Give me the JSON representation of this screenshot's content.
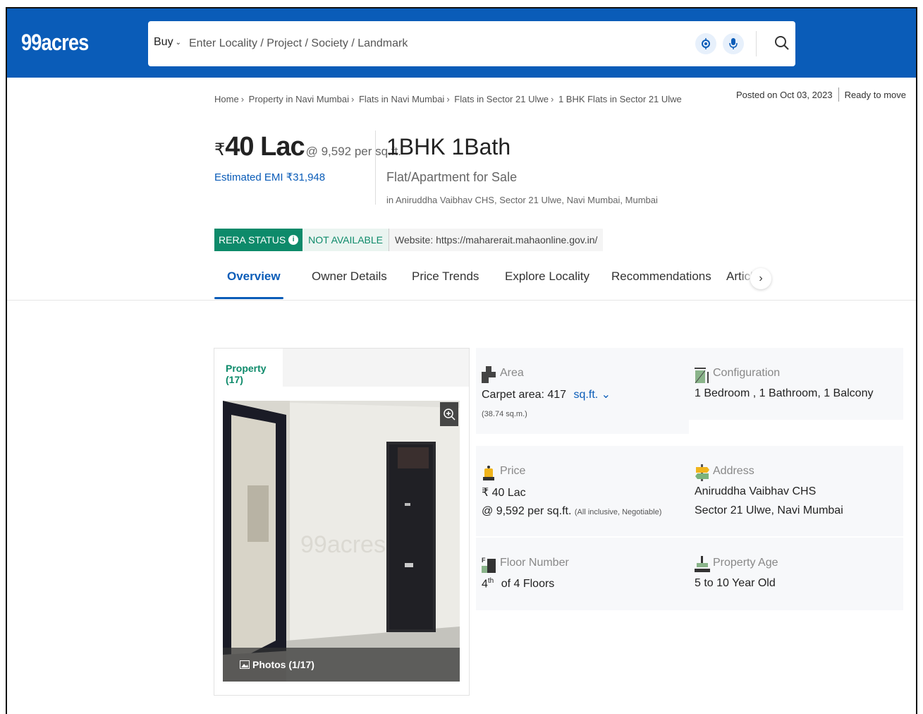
{
  "header": {
    "logo": "99acres",
    "search": {
      "mode": "Buy",
      "placeholder": "Enter Locality / Project / Society / Landmark"
    }
  },
  "meta": {
    "posted": "Posted on Oct 03, 2023",
    "status": "Ready to move"
  },
  "breadcrumb": [
    "Home",
    "Property in Navi Mumbai",
    "Flats in Navi Mumbai",
    "Flats in Sector 21 Ulwe",
    "1 BHK Flats in Sector 21 Ulwe"
  ],
  "listing": {
    "currency": "₹",
    "price": "40 Lac",
    "per_sqft": "@ 9,592 per sq.ft.",
    "emi": "Estimated EMI ₹31,948",
    "config": "1BHK 1Bath",
    "type": "Flat/Apartment for Sale",
    "location": "in Aniruddha Vaibhav CHS, Sector 21 Ulwe, Navi Mumbai, Mumbai"
  },
  "rera": {
    "label": "RERA STATUS",
    "status": "NOT AVAILABLE",
    "website": "Website: https://maharerait.mahaonline.gov.in/"
  },
  "tabs": [
    "Overview",
    "Owner Details",
    "Price Trends",
    "Explore Locality",
    "Recommendations",
    "Articles"
  ],
  "gallery": {
    "tab": "Property (17)",
    "photos_label": "Photos (1/17)"
  },
  "details": {
    "area": {
      "label": "Area",
      "value": "Carpet area: 417",
      "unit": "sq.ft.",
      "sub": "(38.74 sq.m.)"
    },
    "configuration": {
      "label": "Configuration",
      "value": "1 Bedroom , 1 Bathroom, 1 Balcony"
    },
    "price": {
      "label": "Price",
      "value": "₹ 40 Lac",
      "sub": "@ 9,592 per sq.ft.",
      "note": "(All inclusive, Negotiable)"
    },
    "address": {
      "label": "Address",
      "line1": "Aniruddha Vaibhav CHS",
      "line2": "Sector 21 Ulwe, Navi Mumbai"
    },
    "floor": {
      "label": "Floor Number",
      "floor": "4",
      "suffix": "th",
      "value": "of 4 Floors"
    },
    "age": {
      "label": "Property Age",
      "value": "5 to 10 Year Old"
    }
  },
  "colors": {
    "brand": "#0a5cb8",
    "green": "#0d8a6a"
  }
}
